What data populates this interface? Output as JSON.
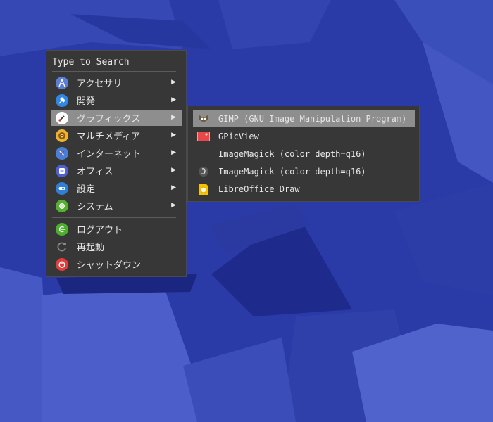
{
  "menu": {
    "search_placeholder": "Type to Search",
    "categories": [
      {
        "label": "アクセサリ",
        "icon": "accessories-icon",
        "color": "#5b7fd6"
      },
      {
        "label": "開発",
        "icon": "development-icon",
        "color": "#2f86e4"
      },
      {
        "label": "グラフィックス",
        "icon": "graphics-icon",
        "color": "#ffffff",
        "selected": true
      },
      {
        "label": "マルチメディア",
        "icon": "multimedia-icon",
        "color": "#f0b030"
      },
      {
        "label": "インターネット",
        "icon": "internet-icon",
        "color": "#4a7fd8"
      },
      {
        "label": "オフィス",
        "icon": "office-icon",
        "color": "#5060d0"
      },
      {
        "label": "設定",
        "icon": "settings-icon",
        "color": "#2f7fd8"
      },
      {
        "label": "システム",
        "icon": "system-icon",
        "color": "#55b030"
      }
    ],
    "session": [
      {
        "label": "ログアウト",
        "icon": "logout-icon",
        "color": "#4caf2e"
      },
      {
        "label": "再起動",
        "icon": "restart-icon",
        "color": "#7a7a7a"
      },
      {
        "label": "シャットダウン",
        "icon": "shutdown-icon",
        "color": "#e23d3d"
      }
    ]
  },
  "submenu": {
    "items": [
      {
        "label": "GIMP (GNU Image Manipulation Program)",
        "icon": "gimp-icon",
        "selected": true
      },
      {
        "label": "GPicView",
        "icon": "gpicview-icon"
      },
      {
        "label": "ImageMagick (color depth=q16)",
        "icon": ""
      },
      {
        "label": "ImageMagick (color depth=q16)",
        "icon": "imagemagick-icon"
      },
      {
        "label": "LibreOffice Draw",
        "icon": "libreoffice-draw-icon"
      }
    ]
  },
  "colors": {
    "desktop": "#2a3aa6",
    "menu_bg": "#373737",
    "selection": "#8e8e8e",
    "text": "#e6e6e6"
  }
}
